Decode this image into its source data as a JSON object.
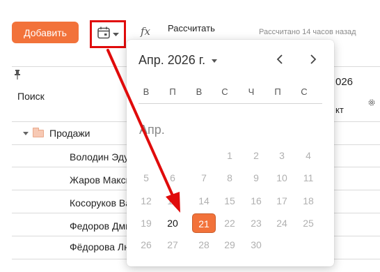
{
  "toolbar": {
    "add_label": "Добавить",
    "calendar_icon": "calendar-icon",
    "fx_label": "fx",
    "calc_label": "Рассчитать",
    "calc_status": "Рассчитано 14 часов назад"
  },
  "table": {
    "search_label": "Поиск",
    "group_label": "Продажи",
    "people": [
      "Володин Эдуард",
      "Жаров Максим",
      "Косоруков Валерий",
      "Федоров Дмитрий",
      "Фёдорова Людмила"
    ],
    "right_year": "026",
    "right_col": "кт"
  },
  "calendar": {
    "month_select": "Апр. 2026 г.",
    "weekdays": [
      "В",
      "П",
      "В",
      "С",
      "Ч",
      "П",
      "С"
    ],
    "month_label": "Апр.",
    "weeks": [
      [
        "",
        "",
        "",
        "1",
        "2",
        "3",
        "4"
      ],
      [
        "5",
        "6",
        "7",
        "8",
        "9",
        "10",
        "11"
      ],
      [
        "12",
        "13",
        "14",
        "15",
        "16",
        "17",
        "18"
      ],
      [
        "19",
        "20",
        "21",
        "22",
        "23",
        "24",
        "25"
      ],
      [
        "26",
        "27",
        "28",
        "29",
        "30",
        "",
        ""
      ]
    ],
    "today": "20",
    "selected": "21",
    "accent_color": "#f2723a"
  },
  "annotation": {
    "color": "#e00b0b"
  }
}
